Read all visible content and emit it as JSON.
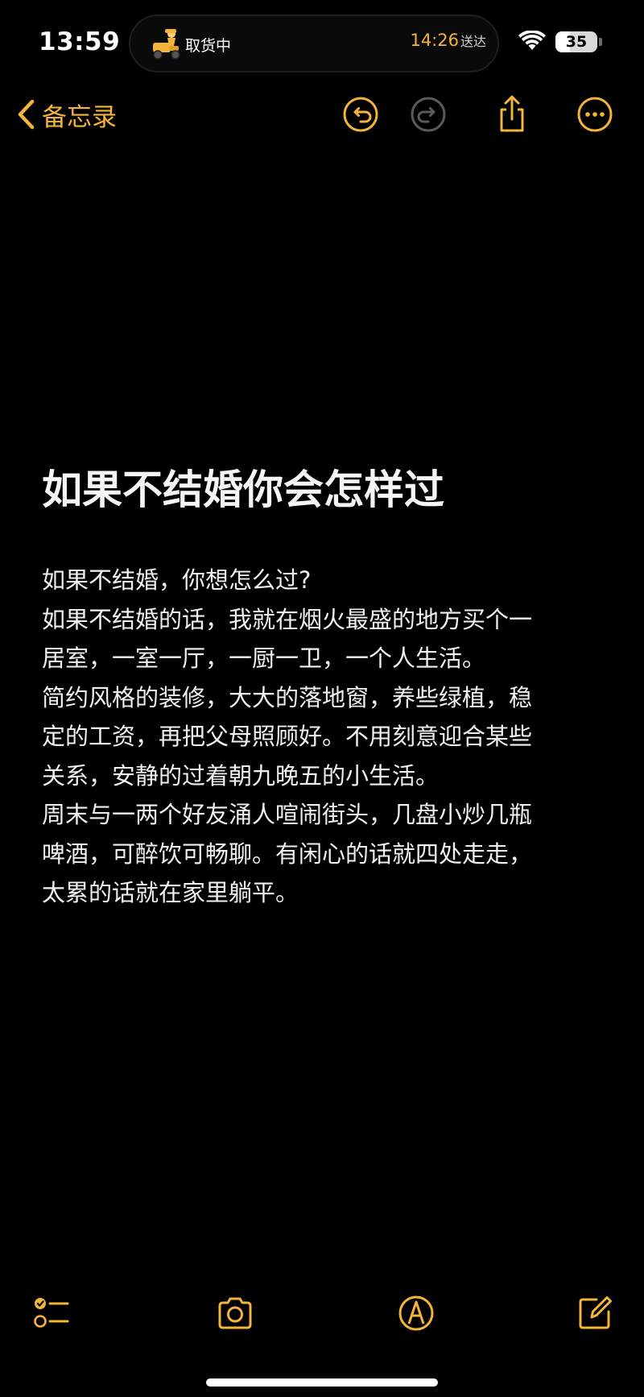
{
  "status_bar": {
    "time": "13:59",
    "live_activity": {
      "status_text": "取货中",
      "eta_time": "14:26",
      "eta_label": "送达",
      "icon": "courier-scooter-icon"
    },
    "battery": {
      "level_text": "35",
      "level_fraction": 0.35
    },
    "icons": [
      "wifi-icon",
      "battery-icon"
    ]
  },
  "nav": {
    "back_label": "备忘录",
    "icons": [
      "chevron-left-icon",
      "undo-icon",
      "redo-icon",
      "share-icon",
      "more-icon"
    ]
  },
  "note": {
    "title": "如果不结婚你会怎样过",
    "lines": [
      "如果不结婚，你想怎么过?",
      "如果不结婚的话，我就在烟火最盛的地方买个一",
      "居室，一室一厅，一厨一卫，一个人生活。",
      "简约风格的装修，大大的落地窗，养些绿植，稳",
      "定的工资，再把父母照顾好。不用刻意迎合某些",
      "关系，安静的过着朝九晚五的小生活。",
      "周末与一两个好友涌人喧闹街头，几盘小炒几瓶",
      "啤酒，可醉饮可畅聊。有闲心的话就四处走走，",
      "太累的话就在家里躺平。"
    ]
  },
  "toolbar": {
    "icons": [
      "checklist-icon",
      "camera-icon",
      "markup-icon",
      "compose-icon"
    ]
  },
  "colors": {
    "accent": "#f2b53a",
    "disabled": "#5a5a5a",
    "background": "#000000",
    "text": "#f0f0f0"
  }
}
